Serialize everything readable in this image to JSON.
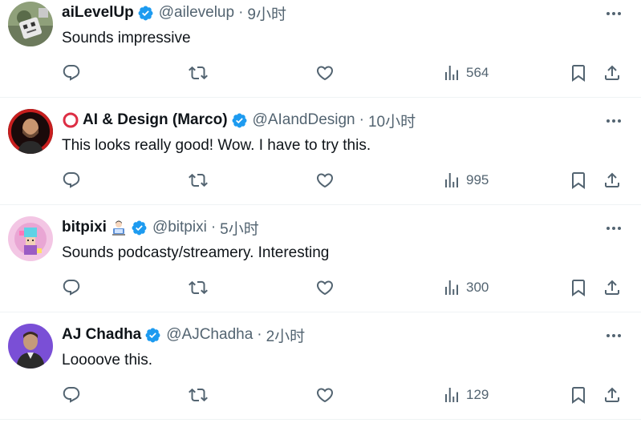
{
  "tweets": [
    {
      "name": "aiLevelUp",
      "handle": "@ailevelup",
      "time": "9小时",
      "text": "Sounds impressive",
      "views": "564",
      "avatar_icon": "robot-mascot-avatar",
      "emoji": null,
      "prefix_icon": null
    },
    {
      "name": "AI & Design (Marco)",
      "handle": "@AIandDesign",
      "time": "10小时",
      "text": "This looks really good! Wow. I have to try this.",
      "views": "995",
      "avatar_icon": "man-portrait-avatar",
      "emoji": null,
      "prefix_icon": "red-circle-icon"
    },
    {
      "name": "bitpixi",
      "handle": "@bitpixi",
      "time": "5小时",
      "text": "Sounds podcasty/streamery. Interesting",
      "views": "300",
      "avatar_icon": "pixel-character-avatar",
      "emoji": "technologist-emoji",
      "prefix_icon": null
    },
    {
      "name": "AJ Chadha",
      "handle": "@AJChadha",
      "time": "2小时",
      "text": "Loooove this.",
      "views": "129",
      "avatar_icon": "man-purple-background-avatar",
      "emoji": null,
      "prefix_icon": null
    }
  ],
  "separator": "·",
  "colors": {
    "text": "#0f1419",
    "secondary": "#536471",
    "verified": "#1d9bf0",
    "divider": "#eff3f4"
  }
}
